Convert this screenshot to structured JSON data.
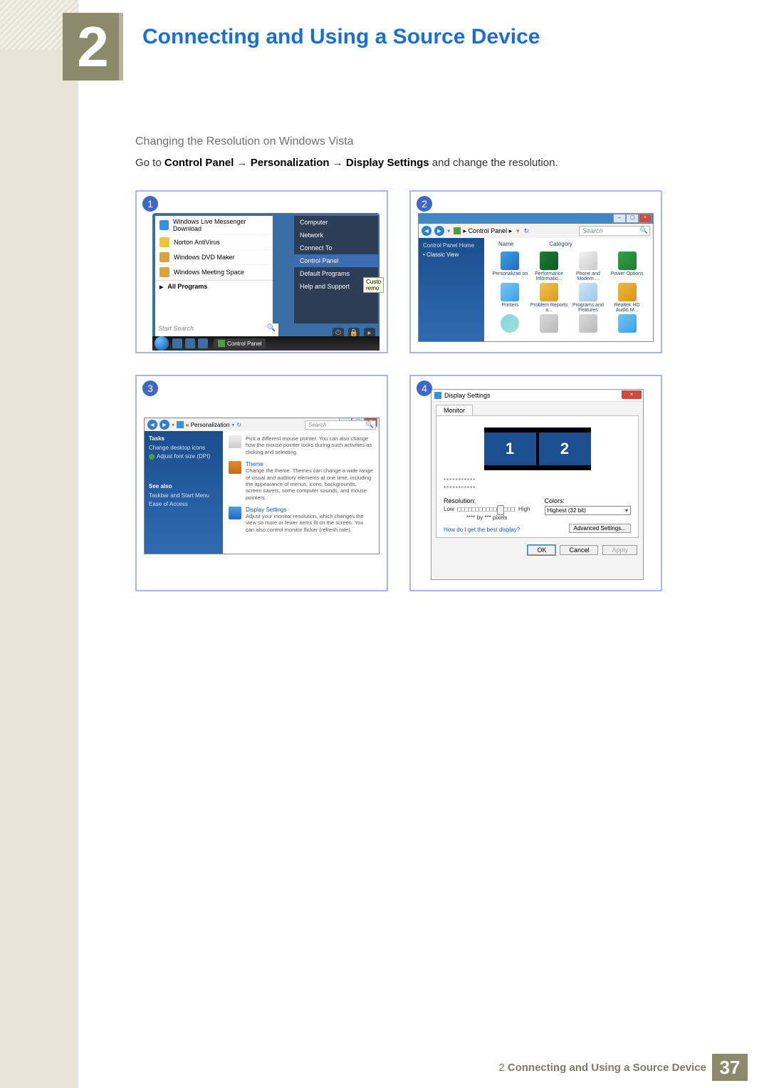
{
  "chapter": {
    "number": "2",
    "title": "Connecting and Using a Source Device"
  },
  "subheading": "Changing the Resolution on Windows Vista",
  "instruction": {
    "prefix": "Go to ",
    "path1": "Control Panel",
    "arrow": "→",
    "path2": "Personalization",
    "path3": "Display Settings",
    "suffix": " and change the resolution."
  },
  "shots": {
    "s1": {
      "badge": "1",
      "left_items": [
        "Windows Live Messenger Download",
        "Norton AntiVirus",
        "Windows DVD Maker",
        "Windows Meeting Space"
      ],
      "all_programs": "All Programs",
      "right_items": [
        "Computer",
        "Network",
        "Connect To",
        "Control Panel",
        "Default Programs",
        "Help and Support"
      ],
      "tooltip": [
        "Custo",
        "remo"
      ],
      "search_placeholder": "Start Search",
      "taskbar_button": "Control Panel"
    },
    "s2": {
      "badge": "2",
      "win_buttons": [
        "–",
        "▢",
        "×"
      ],
      "breadcrumb": "Control Panel",
      "search_placeholder": "Search",
      "sidebar": {
        "home": "Control Panel Home",
        "classic": "Classic View"
      },
      "headers": [
        "Name",
        "Category"
      ],
      "icons": [
        "Personalizati on",
        "Performance Informatio...",
        "Phone and Modem ...",
        "Power Options",
        "Printers",
        "Problem Reports a...",
        "Programs and Features",
        "Realtek HD Audio M..."
      ]
    },
    "s3": {
      "badge": "3",
      "breadcrumb": "Personalization",
      "search_placeholder": "Search",
      "sidebar": {
        "tasks": "Tasks",
        "links": [
          "Change desktop icons",
          "Adjust font size (DPI)"
        ],
        "seealso": "See also",
        "seealso_links": [
          "Taskbar and Start Menu",
          "Ease of Access"
        ]
      },
      "sections": [
        {
          "title": "",
          "body": "Pick a different mouse pointer. You can also change how the mouse pointer looks during such activities as clicking and selecting."
        },
        {
          "title": "Theme",
          "body": "Change the theme. Themes can change a wide range of visual and auditory elements at one time, including the appearance of menus, icons, backgrounds, screen savers, some computer sounds, and mouse pointers."
        },
        {
          "title": "Display Settings",
          "body": "Adjust your monitor resolution, which changes the view so more or fewer items fit on the screen. You can also control monitor flicker (refresh rate)."
        }
      ]
    },
    "s4": {
      "badge": "4",
      "title": "Display Settings",
      "close": "×",
      "tab": "Monitor",
      "monitors": [
        "1",
        "2"
      ],
      "masked": "***********",
      "resolution_label": "Resolution:",
      "low": "Low",
      "high": "High",
      "px_line": "**** by *** pixels",
      "colors_label": "Colors:",
      "colors_value": "Highest (32 bit)",
      "link": "How do I get the best display?",
      "advanced": "Advanced Settings...",
      "buttons": {
        "ok": "OK",
        "cancel": "Cancel",
        "apply": "Apply"
      }
    }
  },
  "footer": {
    "chapter_num": "2",
    "chapter_title": "Connecting and Using a Source Device",
    "page": "37"
  }
}
